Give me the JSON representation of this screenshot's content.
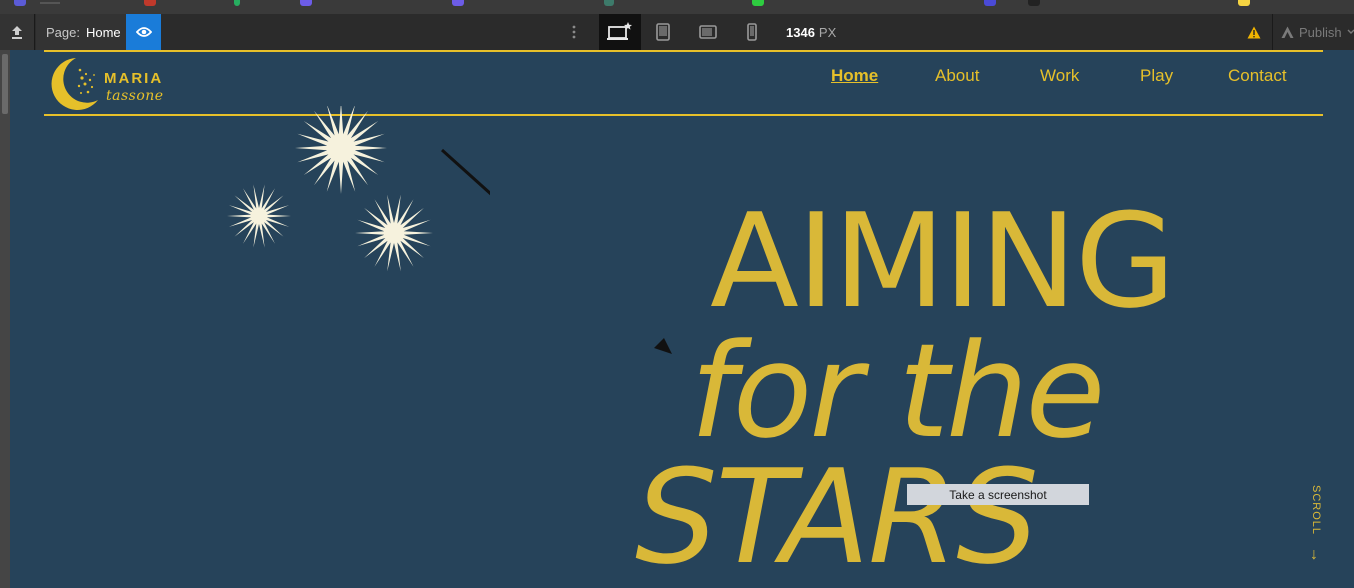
{
  "toolbar": {
    "page_label": "Page:",
    "page_value": "Home",
    "width_value": "1346",
    "width_unit": "PX",
    "publish_label": "Publish"
  },
  "toolbar_icons": [
    "upload-icon",
    "eye-icon",
    "more-vertical-icon",
    "desktop-star-icon",
    "tablet-icon",
    "tablet-landscape-icon",
    "phone-icon",
    "warning-icon",
    "publish-icon",
    "chevron-down-icon"
  ],
  "site": {
    "logo": {
      "name": "MARIA",
      "sub": "tassone"
    },
    "nav": [
      {
        "label": "Home",
        "active": true
      },
      {
        "label": "About",
        "active": false
      },
      {
        "label": "Work",
        "active": false
      },
      {
        "label": "Play",
        "active": false
      },
      {
        "label": "Contact",
        "active": false
      }
    ],
    "hero": {
      "line1": "AIMING",
      "line2": "for the",
      "line3": "STARS"
    },
    "scroll_label": "SCROLL",
    "scroll_arrow": "↓"
  },
  "tooltip": "Take a screenshot",
  "colors": {
    "background": "#26435a",
    "accent": "#e6c02a",
    "hero_text": "#d9b838",
    "preview_blue": "#1a7cd9",
    "toolbar": "#2b2b2b"
  }
}
